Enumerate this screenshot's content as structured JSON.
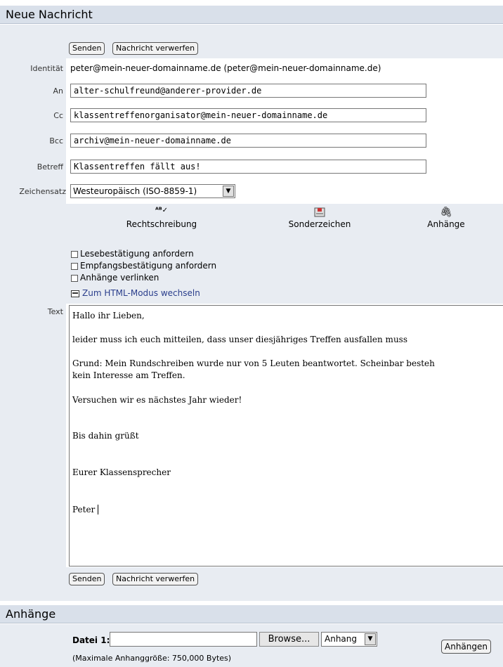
{
  "compose": {
    "title": "Neue Nachricht",
    "send_label": "Senden",
    "discard_label": "Nachricht verwerfen",
    "identity_label": "Identität",
    "identity_value": "peter@mein-neuer-domainname.de (peter@mein-neuer-domainname.de)",
    "to_label": "An",
    "to_value": "alter-schulfreund@anderer-provider.de",
    "cc_label": "Cc",
    "cc_value": "klassentreffenorganisator@mein-neuer-domainname.de",
    "bcc_label": "Bcc",
    "bcc_value": "archiv@mein-neuer-domainname.de",
    "subject_label": "Betreff",
    "subject_value": "Klassentreffen fällt aus!",
    "charset_label": "Zeichensatz",
    "charset_value": "Westeuropäisch (ISO-8859-1)",
    "tools": {
      "spell_label": "Rechtschreibung",
      "special_label": "Sonderzeichen",
      "attach_label": "Anhänge"
    },
    "options": {
      "read_receipt": "Lesebestätigung anfordern",
      "delivery_receipt": "Empfangsbestätigung anfordern",
      "link_attachments": "Anhänge verlinken",
      "html_mode": "Zum HTML-Modus wechseln"
    },
    "text_label": "Text",
    "body_lines": [
      "Hallo ihr Lieben,",
      "leider muss ich euch mitteilen, dass unser diesjähriges Treffen ausfallen muss",
      "Grund: Mein Rundschreiben wurde nur von 5 Leuten beantwortet. Scheinbar besteh",
      "kein Interesse am Treffen.",
      "Versuchen wir es nächstes Jahr wieder!",
      "Bis dahin grüßt",
      "Eurer Klassensprecher",
      "Peter"
    ]
  },
  "attachments": {
    "title": "Anhänge",
    "file_label": "Datei 1:",
    "file_value": "",
    "browse_label": "Browse...",
    "disposition_value": "Anhang",
    "attach_button_label": "Anhängen",
    "max_size_note": "(Maximale Anhanggröße: 750,000 Bytes)"
  }
}
